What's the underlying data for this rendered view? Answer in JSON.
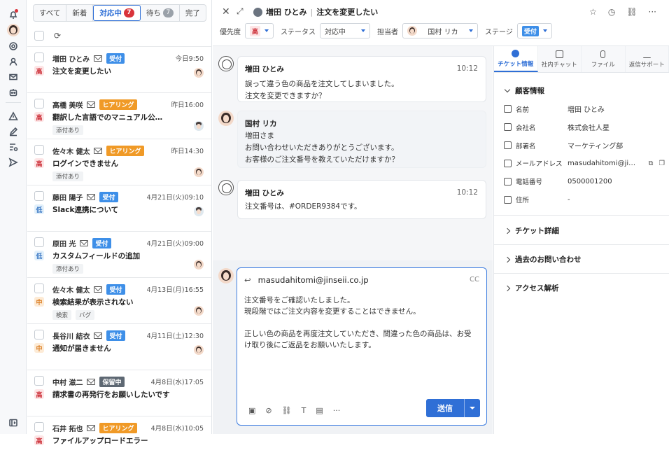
{
  "list": {
    "tabs": [
      {
        "label": "すべて",
        "count": ""
      },
      {
        "label": "新着",
        "count": ""
      },
      {
        "label": "対応中",
        "count": "7"
      },
      {
        "label": "待ち",
        "count": "7"
      },
      {
        "label": "完了",
        "count": ""
      }
    ],
    "items": [
      {
        "name": "増田 ひとみ",
        "badge": "受付",
        "badge_type": "recv",
        "time": "今日9:50",
        "priority": "高",
        "pri_type": "h",
        "subject": "注文を変更したい",
        "tags": [],
        "avatar": "f"
      },
      {
        "name": "高橋 美咲",
        "badge": "ヒアリング",
        "badge_type": "hear",
        "time": "昨日16:00",
        "priority": "高",
        "pri_type": "h",
        "subject": "翻訳した言語でのマニュアル公…",
        "tags": [
          "添付あり"
        ],
        "avatar": "m"
      },
      {
        "name": "佐々木 健太",
        "badge": "ヒアリング",
        "badge_type": "hear",
        "time": "昨日14:30",
        "priority": "高",
        "pri_type": "h",
        "subject": "ログインできません",
        "tags": [
          "添付あり"
        ],
        "avatar": "f"
      },
      {
        "name": "藤田 陽子",
        "badge": "受付",
        "badge_type": "recv",
        "time": "4月21日(火)09:10",
        "priority": "低",
        "pri_type": "l",
        "subject": "Slack連携について",
        "tags": [],
        "avatar": "m"
      },
      {
        "name": "原田 光",
        "badge": "受付",
        "badge_type": "recv",
        "time": "4月21日(火)09:00",
        "priority": "低",
        "pri_type": "l",
        "subject": "カスタムフィールドの追加",
        "tags": [
          "添付あり"
        ],
        "avatar": "f"
      },
      {
        "name": "佐々木 健太",
        "badge": "受付",
        "badge_type": "recv",
        "time": "4月13日(月)16:55",
        "priority": "中",
        "pri_type": "m",
        "subject": "検索結果が表示されない",
        "tags": [
          "検索",
          "バグ"
        ],
        "avatar": "f"
      },
      {
        "name": "長谷川 結衣",
        "badge": "受付",
        "badge_type": "recv",
        "time": "4月11日(土)12:30",
        "priority": "中",
        "pri_type": "m",
        "subject": "通知が届きません",
        "tags": [],
        "avatar": "f"
      },
      {
        "name": "中村 滋二",
        "badge": "保留中",
        "badge_type": "hold",
        "time": "4月8日(水)17:05",
        "priority": "高",
        "pri_type": "h",
        "subject": "請求書の再発行をお願いしたいです",
        "tags": [],
        "avatar": ""
      },
      {
        "name": "石井 拓也",
        "badge": "ヒアリング",
        "badge_type": "hear",
        "time": "4月8日(水)10:05",
        "priority": "高",
        "pri_type": "h",
        "subject": "ファイルアップロードエラー",
        "tags": [],
        "avatar": ""
      }
    ]
  },
  "header": {
    "customer": "増田 ひとみ",
    "subject": "注文を変更したい",
    "priority_label": "優先度",
    "priority_value": "高",
    "status_label": "ステータス",
    "status_value": "対応中",
    "assignee_label": "担当者",
    "assignee_value": "国村 リカ",
    "stage_label": "ステージ",
    "stage_value": "受付"
  },
  "messages": [
    {
      "sender": "増田 ひとみ",
      "time": "10:12",
      "body": "誤って違う色の商品を注文してしまいました。\n注文を変更できますか？"
    },
    {
      "sender": "国村 リカ",
      "time": "",
      "body": "増田さま\nお問い合わせいただきありがとうございます。\nお客様のご注文番号を教えていただけますか？"
    },
    {
      "sender": "増田 ひとみ",
      "time": "10:12",
      "body": "注文番号は、#ORDER9384です。"
    }
  ],
  "reply": {
    "to": "masudahitomi@jinseii.co.jp",
    "cc": "CC",
    "body": "注文番号をご確認いたしました。\n現段階ではご注文内容を変更することはできません。\n\n正しい色の商品を再度注文していただき、間違った色の商品は、お受\nけ取り後にご返品をお願いいたします。",
    "send_label": "送信"
  },
  "side": {
    "tabs": [
      "チケット情報",
      "社内チャット",
      "ファイル",
      "返信サポート"
    ],
    "customer_section": "顧客情報",
    "fields": [
      {
        "label": "名前",
        "value": "増田 ひとみ"
      },
      {
        "label": "会社名",
        "value": "株式会社人星"
      },
      {
        "label": "部署名",
        "value": "マーケティング部"
      },
      {
        "label": "メールアドレス",
        "value": "masudahitomi@ji…"
      },
      {
        "label": "電話番号",
        "value": "0500001200"
      },
      {
        "label": "住所",
        "value": "-"
      }
    ],
    "sections": [
      "チケット詳細",
      "過去のお問い合わせ",
      "アクセス解析"
    ]
  },
  "colors": {
    "accent": "#2f6fd6",
    "high": "#c9262f",
    "received": "#3e8fe8",
    "hearing": "#f09a27",
    "hold": "#5e6873"
  }
}
